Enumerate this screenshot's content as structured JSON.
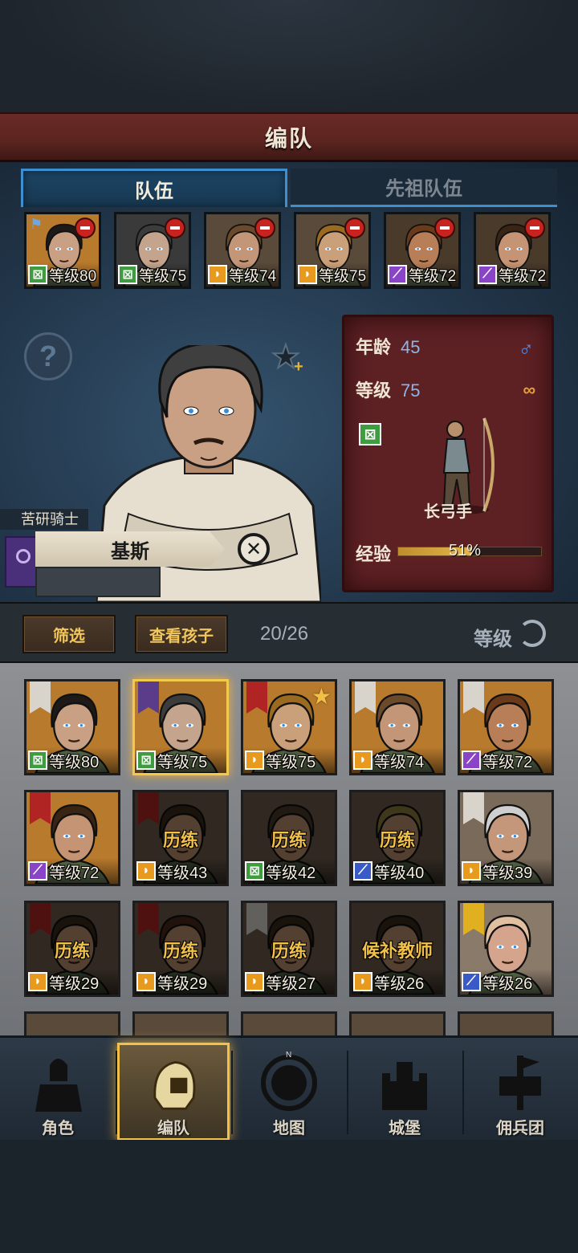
{
  "title": "编队",
  "tabs": [
    {
      "label": "队伍",
      "active": true
    },
    {
      "label": "先祖队伍",
      "active": false
    }
  ],
  "team": [
    {
      "level": "等级80",
      "class_icon": "crossbow-icon",
      "class_color": "#3f9c3f",
      "has_star": true,
      "flag": true,
      "skin": "#c9a084",
      "hair": "#1d1a18",
      "bg": "#b87a2c"
    },
    {
      "level": "等级75",
      "class_icon": "crossbow-icon",
      "class_color": "#3f9c3f",
      "has_star": false,
      "flag": false,
      "skin": "#c4a48c",
      "hair": "#3c3c3c",
      "bg": "#3a3a3a"
    },
    {
      "level": "等级74",
      "class_icon": "shield-icon",
      "class_color": "#e89a1e",
      "has_star": false,
      "flag": false,
      "skin": "#c49678",
      "hair": "#6a4a2a",
      "bg": "#5a4a3a"
    },
    {
      "level": "等级75",
      "class_icon": "shield-icon",
      "class_color": "#e89a1e",
      "has_star": true,
      "flag": false,
      "skin": "#caa07a",
      "hair": "#9a6a20",
      "bg": "#5a4a3a"
    },
    {
      "level": "等级72",
      "class_icon": "staff-icon",
      "class_color": "#8a44c8",
      "has_star": false,
      "flag": false,
      "skin": "#b87e58",
      "hair": "#6a3a1a",
      "bg": "#4a3a2a"
    },
    {
      "level": "等级72",
      "class_icon": "staff-icon",
      "class_color": "#8a44c8",
      "has_star": true,
      "flag": false,
      "skin": "#c49474",
      "hair": "#3a2414",
      "bg": "#4a3a2a"
    }
  ],
  "hero": {
    "rank_title": "苦研骑士",
    "name": "基斯",
    "age_label": "年龄",
    "age": "45",
    "level_label": "等级",
    "level": "75",
    "gender_icon": "♂",
    "class_name": "长弓手",
    "exp_label": "经验",
    "exp_text": "51%",
    "exp_fraction": 0.51
  },
  "filter": {
    "filter_label": "筛选",
    "children_label": "查看孩子",
    "count": "20/26",
    "sort_label": "等级"
  },
  "roster": [
    {
      "level": "等级80",
      "class_icon": "crossbow-icon",
      "class_color": "#3f9c3f",
      "star": true,
      "task": "",
      "dim": false,
      "banner": "#d8d4cc",
      "skin": "#c9a084",
      "hair": "#1d1a18",
      "bg": "#b87a2c",
      "gold_star": false,
      "selected": false
    },
    {
      "level": "等级75",
      "class_icon": "crossbow-icon",
      "class_color": "#3f9c3f",
      "star": false,
      "task": "",
      "dim": false,
      "banner": "#5a3c8a",
      "skin": "#c4a48c",
      "hair": "#3c3c3c",
      "bg": "#b87a2c",
      "gold_star": false,
      "selected": true
    },
    {
      "level": "等级75",
      "class_icon": "shield-icon",
      "class_color": "#e89a1e",
      "star": true,
      "task": "",
      "dim": false,
      "banner": "#b02424",
      "skin": "#caa07a",
      "hair": "#9a6a20",
      "bg": "#b87a2c",
      "gold_star": true,
      "selected": false
    },
    {
      "level": "等级74",
      "class_icon": "shield-icon",
      "class_color": "#e89a1e",
      "star": false,
      "task": "",
      "dim": false,
      "banner": "#d8d4cc",
      "skin": "#c49678",
      "hair": "#6a4a2a",
      "bg": "#b87a2c",
      "gold_star": false,
      "selected": false
    },
    {
      "level": "等级72",
      "class_icon": "staff-icon",
      "class_color": "#8a44c8",
      "star": false,
      "task": "",
      "dim": false,
      "banner": "#d8d4cc",
      "skin": "#b87e58",
      "hair": "#6a3a1a",
      "bg": "#b87a2c",
      "gold_star": false,
      "selected": false
    },
    {
      "level": "等级72",
      "class_icon": "staff-icon",
      "class_color": "#8a44c8",
      "star": true,
      "task": "",
      "dim": false,
      "banner": "#b02424",
      "skin": "#c49474",
      "hair": "#3a2414",
      "bg": "#b87a2c",
      "gold_star": false,
      "selected": false
    },
    {
      "level": "等级43",
      "class_icon": "shield-icon",
      "class_color": "#e89a1e",
      "star": false,
      "task": "历练",
      "dim": true,
      "banner": "#b02424",
      "skin": "#b88e6e",
      "hair": "#3a2a1a",
      "bg": "#6a5a4a",
      "gold_star": false,
      "selected": false
    },
    {
      "level": "等级42",
      "class_icon": "crossbow-icon",
      "class_color": "#3f9c3f",
      "star": false,
      "task": "历练",
      "dim": true,
      "banner": "",
      "skin": "#b88e6e",
      "hair": "#4a3a2a",
      "bg": "#6a5a4a",
      "gold_star": false,
      "selected": false
    },
    {
      "level": "等级40",
      "class_icon": "sword-icon",
      "class_color": "#3a5ac8",
      "star": false,
      "task": "历练",
      "dim": true,
      "banner": "",
      "skin": "#b88e6e",
      "hair": "#8a7a3a",
      "bg": "#6a5a4a",
      "gold_star": false,
      "selected": false
    },
    {
      "level": "等级39",
      "class_icon": "shield-icon",
      "class_color": "#e89a1e",
      "star": false,
      "task": "",
      "dim": false,
      "banner": "#d8d4cc",
      "skin": "#c4967a",
      "hair": "#cfcfcf",
      "bg": "#7a6a5a",
      "gold_star": false,
      "selected": false
    },
    {
      "level": "等级29",
      "class_icon": "shield-icon",
      "class_color": "#e89a1e",
      "star": false,
      "task": "历练",
      "dim": true,
      "banner": "#b02424",
      "skin": "#b88e6e",
      "hair": "#3a2a1a",
      "bg": "#6a5a4a",
      "gold_star": false,
      "selected": false
    },
    {
      "level": "等级29",
      "class_icon": "shield-icon",
      "class_color": "#e89a1e",
      "star": false,
      "task": "历练",
      "dim": true,
      "banner": "#b02424",
      "skin": "#b88e6e",
      "hair": "#4a2a1a",
      "bg": "#6a5a4a",
      "gold_star": false,
      "selected": false
    },
    {
      "level": "等级27",
      "class_icon": "shield-icon",
      "class_color": "#e89a1e",
      "star": false,
      "task": "历练",
      "dim": true,
      "banner": "#d8d4cc",
      "skin": "#b88e6e",
      "hair": "#3a2a1a",
      "bg": "#6a5a4a",
      "gold_star": false,
      "selected": false
    },
    {
      "level": "等级26",
      "class_icon": "shield-icon",
      "class_color": "#e89a1e",
      "star": false,
      "task": "候补教师",
      "dim": true,
      "banner": "",
      "skin": "#b88e6e",
      "hair": "#3a2a1a",
      "bg": "#6a5a4a",
      "gold_star": false,
      "selected": false
    },
    {
      "level": "等级26",
      "class_icon": "sword-icon",
      "class_color": "#3a5ac8",
      "star": false,
      "task": "",
      "dim": false,
      "banner": "#e0b020",
      "skin": "#d4a48c",
      "hair": "#e0c0a0",
      "bg": "#8a7a6a",
      "gold_star": false,
      "selected": false
    }
  ],
  "nav": [
    {
      "label": "角色",
      "icon": "knight-icon",
      "active": false
    },
    {
      "label": "编队",
      "icon": "helmet-icon",
      "active": true
    },
    {
      "label": "地图",
      "icon": "compass-map-icon",
      "active": false
    },
    {
      "label": "城堡",
      "icon": "castle-icon",
      "active": false
    },
    {
      "label": "佣兵团",
      "icon": "mercenary-banner-icon",
      "active": false
    }
  ]
}
